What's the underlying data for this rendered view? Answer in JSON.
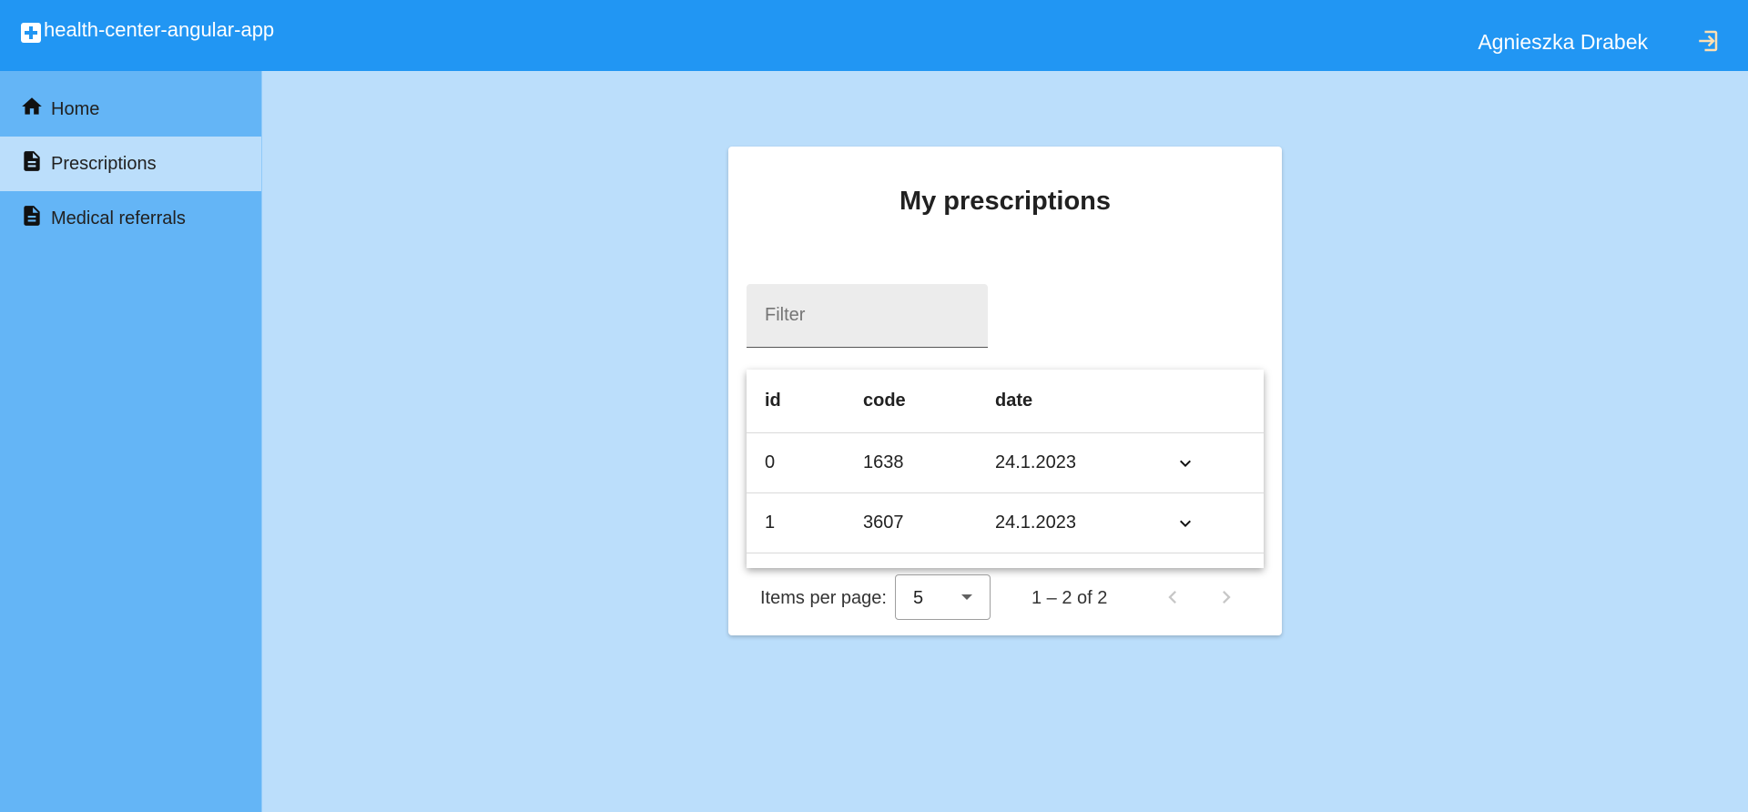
{
  "app": {
    "title": "health-center-angular-app"
  },
  "header": {
    "user_name": "Agnieszka Drabek"
  },
  "sidebar": {
    "items": [
      {
        "label": "Home",
        "icon": "home-icon",
        "active": false
      },
      {
        "label": "Prescriptions",
        "icon": "document-icon",
        "active": true
      },
      {
        "label": "Medical referrals",
        "icon": "document-icon",
        "active": false
      }
    ]
  },
  "main": {
    "title": "My prescriptions",
    "filter": {
      "placeholder": "Filter",
      "value": ""
    },
    "table": {
      "columns": [
        "id",
        "code",
        "date"
      ],
      "rows": [
        {
          "id": "0",
          "code": "1638",
          "date": "24.1.2023"
        },
        {
          "id": "1",
          "code": "3607",
          "date": "24.1.2023"
        }
      ]
    },
    "paginator": {
      "items_per_page_label": "Items per page:",
      "page_size": "5",
      "range_label": "1 – 2 of 2"
    }
  },
  "colors": {
    "primary": "#2196f3",
    "sidenav": "#64b5f6",
    "background": "#bbdefb"
  }
}
